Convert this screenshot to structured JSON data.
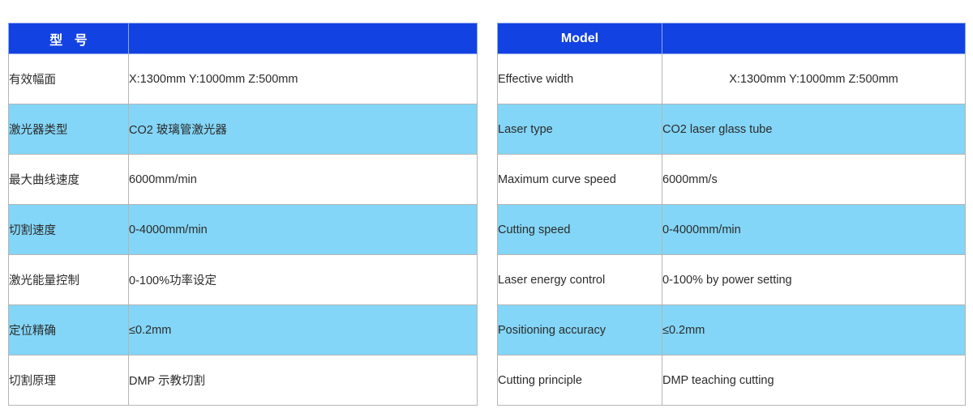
{
  "colors": {
    "header_blue": "#1342e2",
    "row_highlight_blue": "#83d6f7",
    "row_plain": "#ffffff",
    "border_gray": "#b5b5b5",
    "text_dark": "#2b2b2b",
    "header_text": "#ffffff"
  },
  "tables": [
    {
      "id": "spec-table-chinese",
      "language": "zh",
      "header": {
        "label_column": "型 号",
        "value_column": ""
      },
      "rows": [
        {
          "label": "有效幅面",
          "value": "X:1300mm   Y:1000mm   Z:500mm",
          "shaded": false
        },
        {
          "label": "激光器类型",
          "value": "CO2 玻璃管激光器",
          "shaded": true
        },
        {
          "label": "最大曲线速度",
          "value": "6000mm/min",
          "shaded": false
        },
        {
          "label": "切割速度",
          "value": "0-4000mm/min",
          "shaded": true
        },
        {
          "label": "激光能量控制",
          "value": "0-100%功率设定",
          "shaded": false
        },
        {
          "label": "定位精确",
          "value": "≤0.2mm",
          "shaded": true
        },
        {
          "label": "切割原理",
          "value": "DMP 示教切割",
          "shaded": false
        }
      ]
    },
    {
      "id": "spec-table-english",
      "language": "en",
      "header": {
        "label_column": "Model",
        "value_column": ""
      },
      "rows": [
        {
          "label": "Effective width",
          "value": "X:1300mm   Y:1000mm   Z:500mm",
          "shaded": false,
          "value_centered": true
        },
        {
          "label": "Laser type",
          "value": "CO2 laser glass tube",
          "shaded": true,
          "value_centered": false
        },
        {
          "label": "Maximum curve speed",
          "value": "6000mm/s",
          "shaded": false,
          "value_centered": false
        },
        {
          "label": "Cutting speed",
          "value": "0-4000mm/min",
          "shaded": true,
          "value_centered": false
        },
        {
          "label": "Laser energy control",
          "value": "0-100% by power setting",
          "shaded": false,
          "value_centered": false
        },
        {
          "label": "Positioning accuracy",
          "value": "≤0.2mm",
          "shaded": true,
          "value_centered": false
        },
        {
          "label": "Cutting principle",
          "value": "DMP teaching cutting",
          "shaded": false,
          "value_centered": false
        }
      ]
    }
  ]
}
